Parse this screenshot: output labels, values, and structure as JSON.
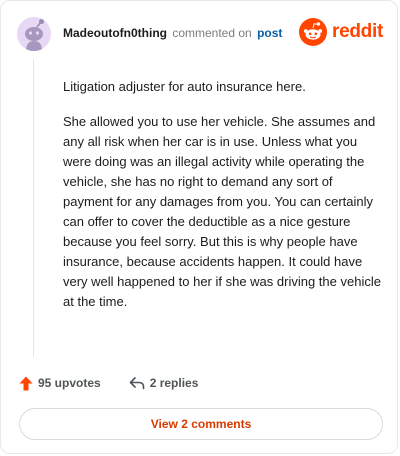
{
  "header": {
    "username": "Madeoutofn0thing",
    "action": "commented on",
    "post_link": "post",
    "logo_text": "reddit"
  },
  "comment": {
    "paragraphs": [
      "Litigation adjuster for auto insurance here.",
      "She allowed you to use her vehicle. She assumes and any all risk when her car is in use. Unless what you were doing was an illegal activity while operating the vehicle, she has no right to demand any sort of payment for any damages from you. You can certainly can offer to cover the deductible as a nice gesture because you feel sorry. But this is why people have insurance, because accidents happen. It could have very well happened to her if she was driving the vehicle at the time."
    ]
  },
  "actions": {
    "upvotes": "95 upvotes",
    "replies": "2 replies"
  },
  "view_button": "View 2 comments",
  "colors": {
    "accent": "#ff4500",
    "link": "#0a5fa7",
    "button_text": "#d93a00"
  }
}
